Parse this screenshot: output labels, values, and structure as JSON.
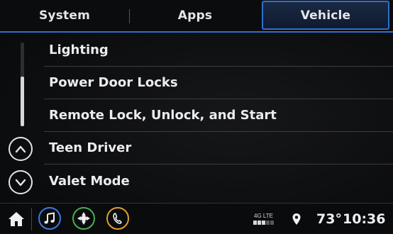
{
  "tabs": {
    "system": "System",
    "apps": "Apps",
    "vehicle": "Vehicle",
    "active": "Vehicle"
  },
  "menu": {
    "items": [
      {
        "label": "Lighting"
      },
      {
        "label": "Power Door Locks"
      },
      {
        "label": "Remote Lock, Unlock, and Start"
      },
      {
        "label": "Teen Driver"
      },
      {
        "label": "Valet Mode"
      }
    ]
  },
  "status": {
    "network": "4G LTE",
    "signal_bars": 3,
    "signal_max": 5,
    "temperature": "73°",
    "time": "10:36"
  },
  "icons": {
    "home": "home-icon",
    "audio": "music-note-icon",
    "navigation": "navigation-icon",
    "phone": "phone-icon",
    "location": "location-pin-icon",
    "scroll_up": "chevron-up-icon",
    "scroll_down": "chevron-down-icon"
  },
  "colors": {
    "accent": "#2f6fd0",
    "audio": "#3a7be0",
    "nav": "#47b04b",
    "phone": "#e0a028"
  }
}
